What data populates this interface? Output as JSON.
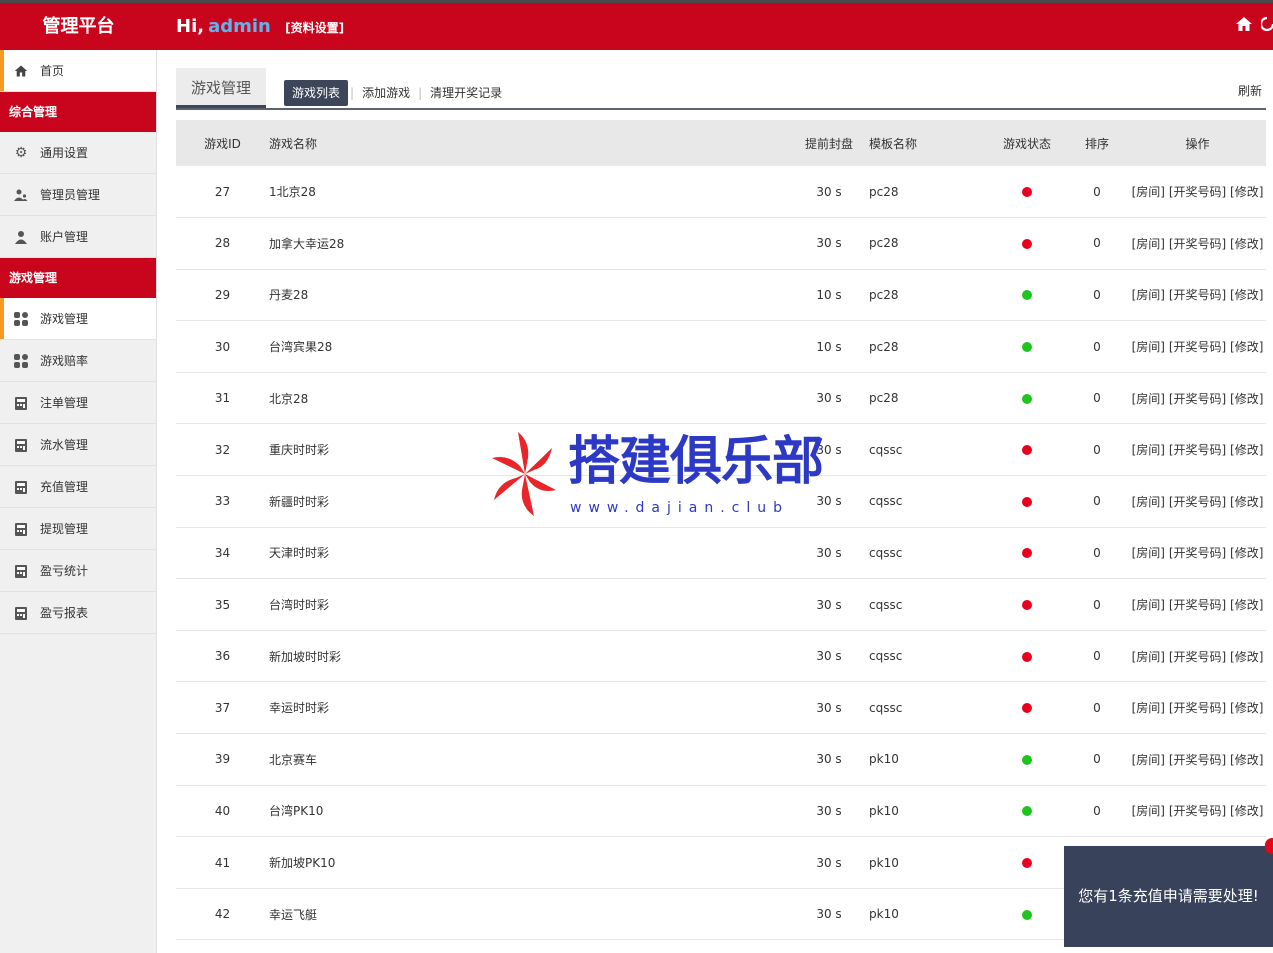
{
  "header": {
    "brand": "管理平台",
    "greeting": "Hi,",
    "username": "admin",
    "profile_link": "[资料设置]",
    "icons": [
      "home-icon",
      "power-icon"
    ]
  },
  "sidebar": {
    "home": "首页",
    "group1": "综合管理",
    "group1_items": [
      "通用设置",
      "管理员管理",
      "账户管理"
    ],
    "group2": "游戏管理",
    "group2_items": [
      "游戏管理",
      "游戏赔率",
      "注单管理",
      "流水管理",
      "充值管理",
      "提现管理",
      "盈亏统计",
      "盈亏报表"
    ]
  },
  "page": {
    "title": "游戏管理",
    "subtabs": [
      "游戏列表",
      "添加游戏",
      "清理开奖记录"
    ],
    "refresh": "刷新"
  },
  "table": {
    "headers": [
      "游戏ID",
      "游戏名称",
      "提前封盘",
      "模板名称",
      "游戏状态",
      "排序",
      "操作"
    ],
    "rows": [
      {
        "id": "27",
        "name": "1北京28",
        "adv": "30 s",
        "tpl": "pc28",
        "status": "red",
        "sort": "0"
      },
      {
        "id": "28",
        "name": "加拿大幸运28",
        "adv": "30 s",
        "tpl": "pc28",
        "status": "red",
        "sort": "0"
      },
      {
        "id": "29",
        "name": "丹麦28",
        "adv": "10 s",
        "tpl": "pc28",
        "status": "green",
        "sort": "0"
      },
      {
        "id": "30",
        "name": "台湾宾果28",
        "adv": "10 s",
        "tpl": "pc28",
        "status": "green",
        "sort": "0"
      },
      {
        "id": "31",
        "name": "北京28",
        "adv": "30 s",
        "tpl": "pc28",
        "status": "green",
        "sort": "0"
      },
      {
        "id": "32",
        "name": "重庆时时彩",
        "adv": "30 s",
        "tpl": "cqssc",
        "status": "red",
        "sort": "0"
      },
      {
        "id": "33",
        "name": "新疆时时彩",
        "adv": "30 s",
        "tpl": "cqssc",
        "status": "red",
        "sort": "0"
      },
      {
        "id": "34",
        "name": "天津时时彩",
        "adv": "30 s",
        "tpl": "cqssc",
        "status": "red",
        "sort": "0"
      },
      {
        "id": "35",
        "name": "台湾时时彩",
        "adv": "30 s",
        "tpl": "cqssc",
        "status": "red",
        "sort": "0"
      },
      {
        "id": "36",
        "name": "新加坡时时彩",
        "adv": "30 s",
        "tpl": "cqssc",
        "status": "red",
        "sort": "0"
      },
      {
        "id": "37",
        "name": "幸运时时彩",
        "adv": "30 s",
        "tpl": "cqssc",
        "status": "red",
        "sort": "0"
      },
      {
        "id": "39",
        "name": "北京赛车",
        "adv": "30 s",
        "tpl": "pk10",
        "status": "green",
        "sort": "0"
      },
      {
        "id": "40",
        "name": "台湾PK10",
        "adv": "30 s",
        "tpl": "pk10",
        "status": "green",
        "sort": "0"
      },
      {
        "id": "41",
        "name": "新加坡PK10",
        "adv": "30 s",
        "tpl": "pk10",
        "status": "red",
        "sort": ""
      },
      {
        "id": "42",
        "name": "幸运飞艇",
        "adv": "30 s",
        "tpl": "pk10",
        "status": "green",
        "sort": ""
      }
    ],
    "ops": [
      "[房间]",
      "[开奖号码]",
      "[修改]"
    ],
    "status_colors": {
      "red": "#e8001c",
      "green": "#1dc51d"
    }
  },
  "toast": {
    "message": "您有1条充值申请需要处理!"
  },
  "watermark": {
    "title": "搭建俱乐部",
    "url": "www.dajian.club"
  }
}
